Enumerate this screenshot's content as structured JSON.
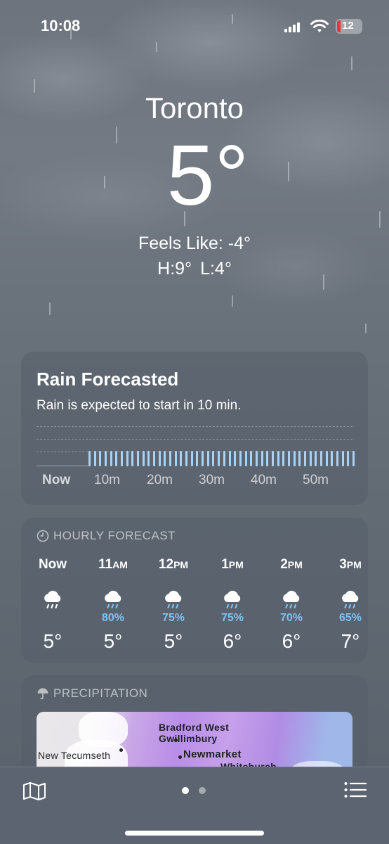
{
  "status_bar": {
    "time": "10:08",
    "battery": "12"
  },
  "hero": {
    "city": "Toronto",
    "temp": "5°",
    "feels_like": "Feels Like: -4°",
    "high": "H:9°",
    "low": "L:4°"
  },
  "rain_card": {
    "title": "Rain Forecasted",
    "subtitle": "Rain is expected to start in 10 min.",
    "axis": [
      "Now",
      "10m",
      "20m",
      "30m",
      "40m",
      "50m"
    ],
    "rain_start_minute": 10
  },
  "hourly": {
    "header": "HOURLY FORECAST",
    "items": [
      {
        "hour": "Now",
        "suffix": "",
        "icon": "rain-icon",
        "pct": "",
        "temp": "5°"
      },
      {
        "hour": "11",
        "suffix": "AM",
        "icon": "rain-cloud-icon",
        "pct": "80%",
        "temp": "5°"
      },
      {
        "hour": "12",
        "suffix": "PM",
        "icon": "rain-cloud-icon",
        "pct": "75%",
        "temp": "5°"
      },
      {
        "hour": "1",
        "suffix": "PM",
        "icon": "rain-cloud-icon",
        "pct": "75%",
        "temp": "6°"
      },
      {
        "hour": "2",
        "suffix": "PM",
        "icon": "rain-cloud-icon",
        "pct": "70%",
        "temp": "6°"
      },
      {
        "hour": "3",
        "suffix": "PM",
        "icon": "rain-cloud-icon",
        "pct": "65%",
        "temp": "7°"
      }
    ]
  },
  "precipitation": {
    "header": "PRECIPITATION",
    "places": [
      "Bradford West",
      "Gwillimbury",
      "New Tecumseth",
      "Newmarket",
      "Whitchurch"
    ]
  },
  "bottom_bar": {
    "page_count": 2,
    "active_page": 1
  },
  "colors": {
    "accent_rain": "#7ec2f2",
    "bar": "#a9d3f5",
    "battery_low": "#e5383b"
  }
}
